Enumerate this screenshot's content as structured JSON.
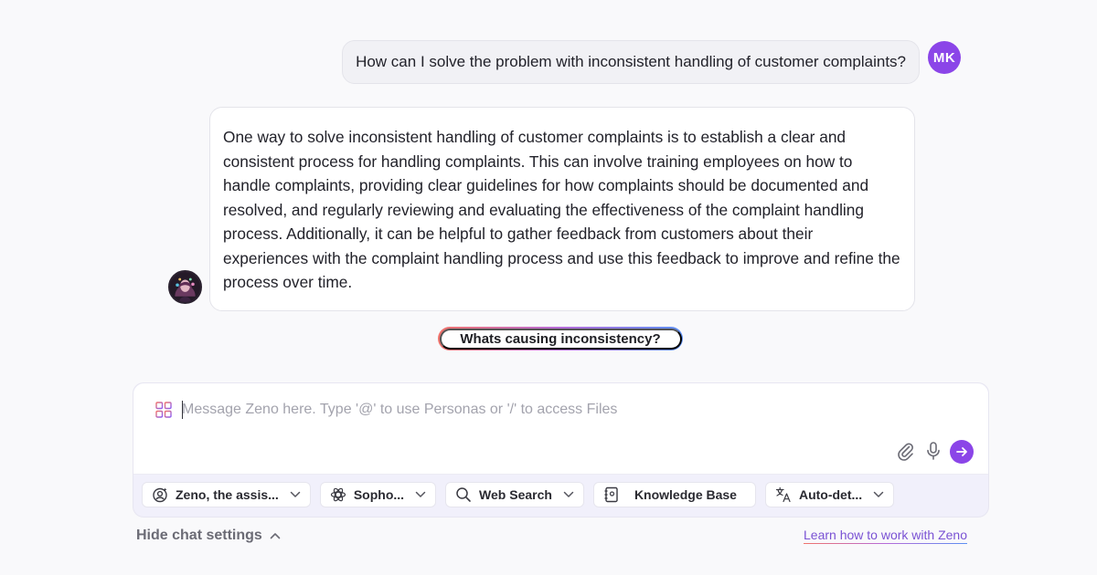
{
  "conversation": {
    "user": {
      "initials": "MK",
      "message": "How can I solve the problem with inconsistent handling of customer complaints?"
    },
    "assistant": {
      "message": "One way to solve inconsistent handling of customer complaints is to establish a clear and consistent process for handling complaints. This can involve training employees on how to handle complaints, providing clear guidelines for how complaints should be documented and resolved, and regularly reviewing and evaluating the effectiveness of the complaint handling process. Additionally, it can be helpful to gather feedback from customers about their experiences with the complaint handling process and use this feedback to improve and refine the process over time."
    },
    "suggestion": "Whats causing inconsistency?"
  },
  "composer": {
    "placeholder": "Message Zeno here. Type '@' to use Personas or '/' to access Files",
    "settings": [
      {
        "label": "Zeno, the assis...",
        "icon": "persona-icon"
      },
      {
        "label": "Sopho...",
        "icon": "model-icon"
      },
      {
        "label": "Web Search",
        "icon": "search-icon"
      },
      {
        "label": "Knowledge Base",
        "icon": "knowledge-base-icon"
      },
      {
        "label": "Auto-det...",
        "icon": "translate-icon"
      }
    ]
  },
  "footer": {
    "hide_settings": "Hide chat settings",
    "learn_link": "Learn how to work with Zeno"
  },
  "colors": {
    "accent": "#8b45e8",
    "link": "#7a52d4"
  }
}
